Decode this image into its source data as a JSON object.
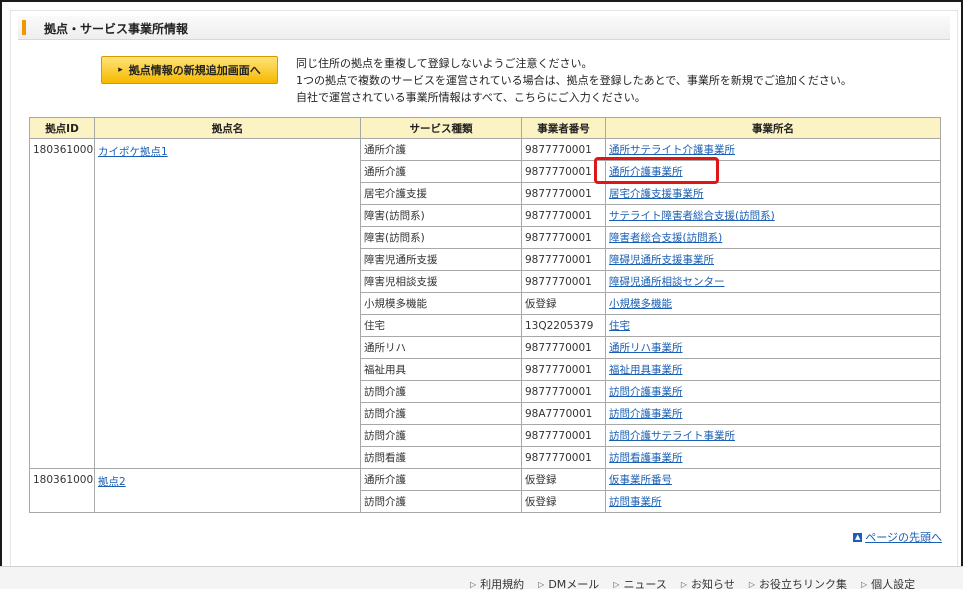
{
  "section": {
    "title": "拠点・サービス事業所情報"
  },
  "new_button": {
    "label": "拠点情報の新規追加画面へ"
  },
  "notes": [
    "同じ住所の拠点を重複して登録しないようご注意ください。",
    "1つの拠点で複数のサービスを運営されている場合は、拠点を登録したあとで、事業所を新規でご追加ください。",
    "自社で運営されている事業所情報はすべて、こちらにご入力ください。"
  ],
  "table": {
    "headers": [
      "拠点ID",
      "拠点名",
      "サービス種類",
      "事業者番号",
      "事業所名"
    ],
    "groups": [
      {
        "id": "1803610002",
        "name": "カイポケ拠点1",
        "rows": [
          {
            "service": "通所介護",
            "number": "9877770001",
            "office": "通所サテライト介護事業所"
          },
          {
            "service": "通所介護",
            "number": "9877770001",
            "office": "通所介護事業所"
          },
          {
            "service": "居宅介護支援",
            "number": "9877770001",
            "office": "居宅介護支援事業所"
          },
          {
            "service": "障害(訪問系)",
            "number": "9877770001",
            "office": "サテライト障害者総合支援(訪問系)"
          },
          {
            "service": "障害(訪問系)",
            "number": "9877770001",
            "office": "障害者総合支援(訪問系)"
          },
          {
            "service": "障害児通所支援",
            "number": "9877770001",
            "office": "障碍児通所支援事業所"
          },
          {
            "service": "障害児相談支援",
            "number": "9877770001",
            "office": "障碍児通所相談センター"
          },
          {
            "service": "小規模多機能",
            "number": "仮登録",
            "office": "小規模多機能"
          },
          {
            "service": "住宅",
            "number": "13Q2205379",
            "office": "住宅"
          },
          {
            "service": "通所リハ",
            "number": "9877770001",
            "office": "通所リハ事業所"
          },
          {
            "service": "福祉用具",
            "number": "9877770001",
            "office": "福祉用具事業所"
          },
          {
            "service": "訪問介護",
            "number": "9877770001",
            "office": "訪問介護事業所"
          },
          {
            "service": "訪問介護",
            "number": "98A7770001",
            "office": "訪問介護事業所"
          },
          {
            "service": "訪問介護",
            "number": "9877770001",
            "office": "訪問介護サテライト事業所"
          },
          {
            "service": "訪問看護",
            "number": "9877770001",
            "office": "訪問看護事業所"
          }
        ]
      },
      {
        "id": "1803610003",
        "name": "拠点2",
        "rows": [
          {
            "service": "通所介護",
            "number": "仮登録",
            "office": "仮事業所番号"
          },
          {
            "service": "訪問介護",
            "number": "仮登録",
            "office": "訪問事業所"
          }
        ]
      }
    ]
  },
  "page_top": {
    "label": "ページの先頭へ",
    "icon": "up-arrow-icon"
  },
  "footer": {
    "links": [
      "利用規約",
      "DMメール",
      "ニュース",
      "お知らせ",
      "お役立ちリンク集",
      "個人設定"
    ]
  },
  "colors": {
    "accent": "#f29600",
    "link": "#1a5fb4",
    "header_bg": "#fbf3c4",
    "highlight": "#e01515"
  }
}
